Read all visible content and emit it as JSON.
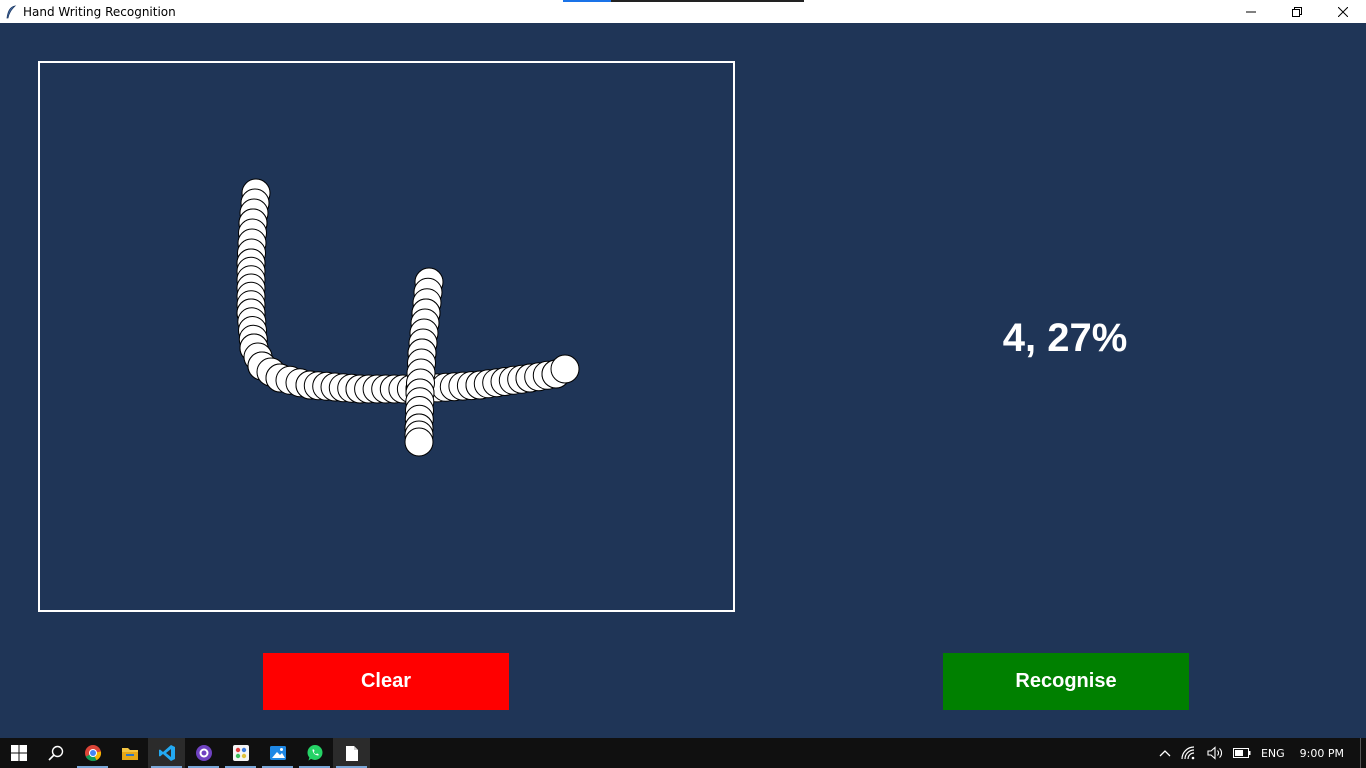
{
  "window": {
    "title": "Hand Writing Recognition",
    "icons": {
      "app": "feather-icon",
      "minimize": "minimize-icon",
      "maximize": "restore-icon",
      "close": "close-icon"
    }
  },
  "canvas": {
    "background": "#1f3557",
    "stroke_color": "#ffffff",
    "drawing": "handwritten digit 4"
  },
  "result": {
    "text": "4, 27%"
  },
  "buttons": {
    "clear": {
      "label": "Clear",
      "color": "#ff0000"
    },
    "recognise": {
      "label": "Recognise",
      "color": "#008000"
    }
  },
  "taskbar": {
    "apps": [
      "windows-start-icon",
      "search-icon",
      "chrome-icon",
      "file-explorer-icon",
      "vscode-icon",
      "github-desktop-icon",
      "paint-icon",
      "photos-icon",
      "whatsapp-icon",
      "notepad-icon"
    ],
    "tray": {
      "language": "ENG",
      "time": "9:00 PM"
    }
  }
}
